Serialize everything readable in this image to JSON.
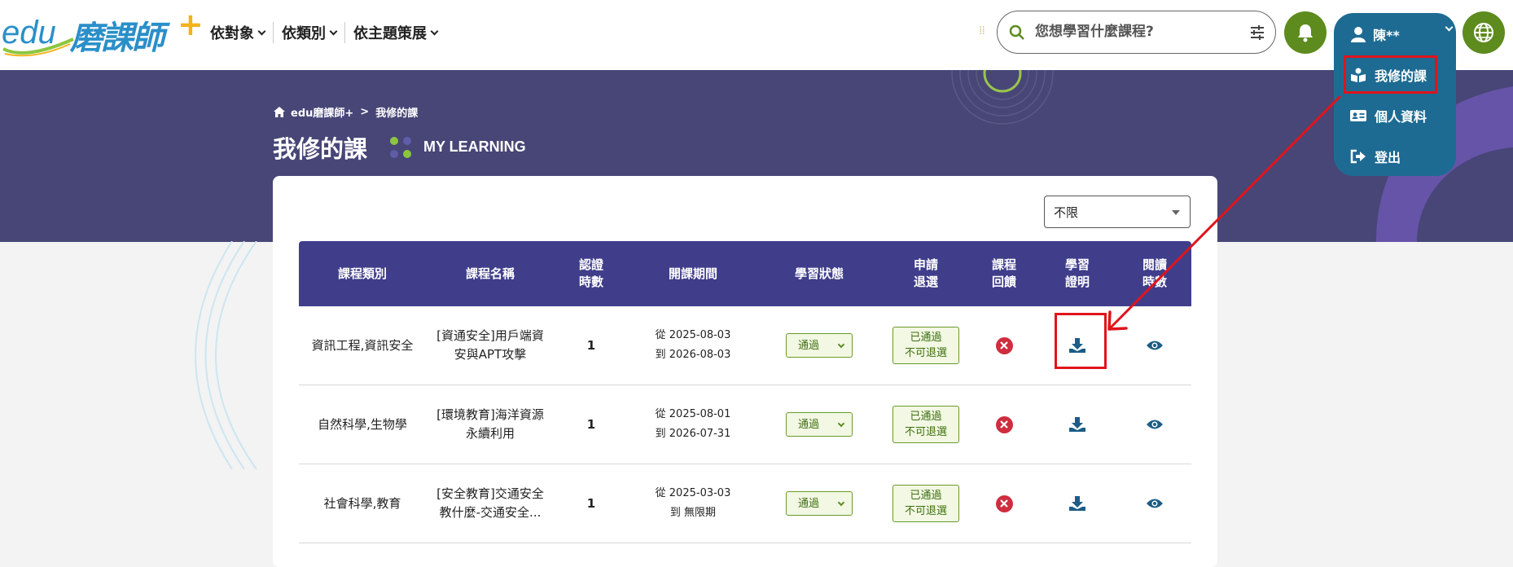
{
  "header": {
    "logo": {
      "edu": "edu",
      "name": "磨課師",
      "plus": "+"
    },
    "nav": [
      {
        "label": "依對象"
      },
      {
        "label": "依類別"
      },
      {
        "label": "依主題策展"
      }
    ],
    "search": {
      "placeholder": "您想學習什麼課程?"
    },
    "user": {
      "name": "陳**",
      "menu": [
        {
          "label": "我修的課",
          "icon": "book-reader-icon"
        },
        {
          "label": "個人資料",
          "icon": "id-card-icon"
        },
        {
          "label": "登出",
          "icon": "sign-out-icon"
        }
      ]
    }
  },
  "banner": {
    "breadcrumb": {
      "home": "edu磨課師+",
      "sep": ">",
      "current": "我修的課"
    },
    "title": "我修的課",
    "subtitle": "MY LEARNING"
  },
  "filter": {
    "selected": "不限"
  },
  "table": {
    "headers": [
      {
        "label": "課程類別"
      },
      {
        "label": "課程名稱"
      },
      {
        "line1": "認證",
        "line2": "時數"
      },
      {
        "label": "開課期間"
      },
      {
        "label": "學習狀態"
      },
      {
        "line1": "申請",
        "line2": "退選"
      },
      {
        "line1": "課程",
        "line2": "回饋"
      },
      {
        "line1": "學習",
        "line2": "證明"
      },
      {
        "line1": "閱讀",
        "line2": "時數"
      }
    ],
    "rows": [
      {
        "category": "資訊工程,資訊安全",
        "name1": "[資通安全]用戶端資",
        "name2": "安與APT攻擊",
        "hours": "1",
        "from": "從 2025-08-03",
        "to": "到 2026-08-03",
        "status": "通過",
        "withdraw1": "已通過",
        "withdraw2": "不可退選"
      },
      {
        "category": "自然科學,生物學",
        "name1": "[環境教育]海洋資源",
        "name2": "永續利用",
        "hours": "1",
        "from": "從 2025-08-01",
        "to": "到 2026-07-31",
        "status": "通過",
        "withdraw1": "已通過",
        "withdraw2": "不可退選"
      },
      {
        "category": "社會科學,教育",
        "name1": "[安全教育]交通安全",
        "name2": "教什麼-交通安全...",
        "hours": "1",
        "from": "從 2025-03-03",
        "to": "到 無限期",
        "status": "通過",
        "withdraw1": "已通過",
        "withdraw2": "不可退選"
      }
    ]
  },
  "colors": {
    "banner": "#474677",
    "table_header": "#403e8b",
    "user_menu": "#1d6b93",
    "green": "#5d8b1e",
    "annotation_red": "#e0141b"
  }
}
